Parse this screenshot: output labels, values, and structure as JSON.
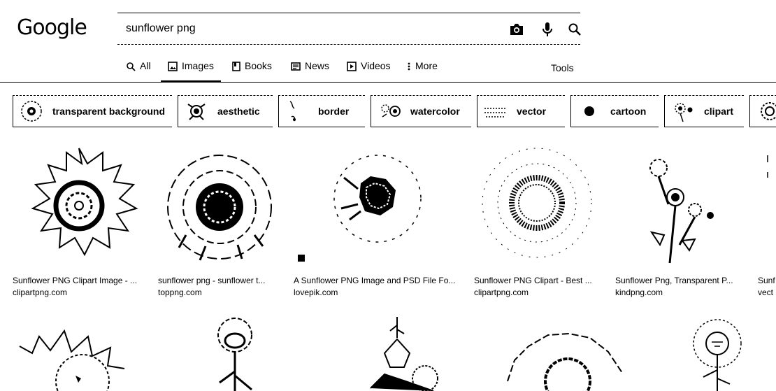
{
  "logo": {
    "text": "Google"
  },
  "search": {
    "query": "sunflower png"
  },
  "tabs": [
    {
      "label": "All",
      "icon": "search-icon"
    },
    {
      "label": "Images",
      "icon": "image-icon",
      "active": true
    },
    {
      "label": "Books",
      "icon": "book-icon"
    },
    {
      "label": "News",
      "icon": "news-icon"
    },
    {
      "label": "Videos",
      "icon": "video-icon"
    },
    {
      "label": "More",
      "icon": "more-vert-icon"
    }
  ],
  "tools_label": "Tools",
  "chips": [
    {
      "label": "transparent background"
    },
    {
      "label": "aesthetic"
    },
    {
      "label": "border"
    },
    {
      "label": "watercolor"
    },
    {
      "label": "vector"
    },
    {
      "label": "cartoon"
    },
    {
      "label": "clipart"
    }
  ],
  "results": [
    {
      "title": "Sunflower PNG Clipart Image - ...",
      "source": "clipartpng.com"
    },
    {
      "title": "sunflower png - sunflower t...",
      "source": "toppng.com"
    },
    {
      "title": "A Sunflower PNG Image and PSD File Fo...",
      "source": "lovepik.com"
    },
    {
      "title": "Sunflower PNG Clipart - Best ...",
      "source": "clipartpng.com"
    },
    {
      "title": "Sunflower Png, Transparent P...",
      "source": "kindpng.com"
    },
    {
      "title": "Sunf",
      "source": "vect"
    }
  ],
  "colors": {
    "text": "#202124",
    "ink": "#000000",
    "background": "#ffffff"
  }
}
